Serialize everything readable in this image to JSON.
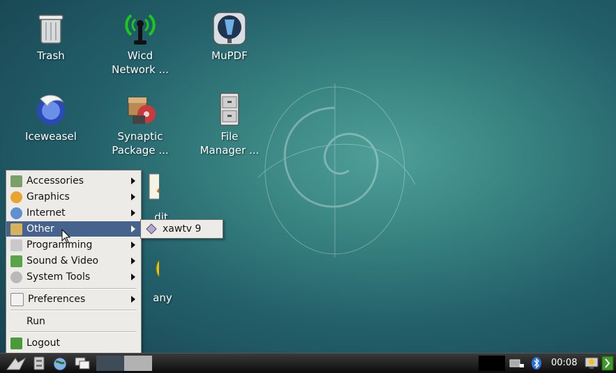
{
  "desktop": {
    "icons": [
      {
        "label": "Trash"
      },
      {
        "label": "Wicd\nNetwork ..."
      },
      {
        "label": "MuPDF"
      },
      {
        "label": "Iceweasel"
      },
      {
        "label": "Synaptic\nPackage ..."
      },
      {
        "label": "File\nManager ..."
      },
      {
        "label": "dit"
      },
      {
        "label": "any"
      }
    ]
  },
  "menu": {
    "items": [
      {
        "label": "Accessories"
      },
      {
        "label": "Graphics"
      },
      {
        "label": "Internet"
      },
      {
        "label": "Other"
      },
      {
        "label": "Programming"
      },
      {
        "label": "Sound & Video"
      },
      {
        "label": "System Tools"
      },
      {
        "label": "Preferences"
      },
      {
        "label": "Run"
      },
      {
        "label": "Logout"
      }
    ],
    "active": "Other"
  },
  "submenu": {
    "items": [
      {
        "label": "xawtv 9"
      }
    ]
  },
  "taskbar": {
    "clock": "00:08"
  },
  "colors": {
    "menu_highlight": "#46638e",
    "menu_bg": "#ecebe8",
    "taskbar": "#1a1a1a"
  }
}
